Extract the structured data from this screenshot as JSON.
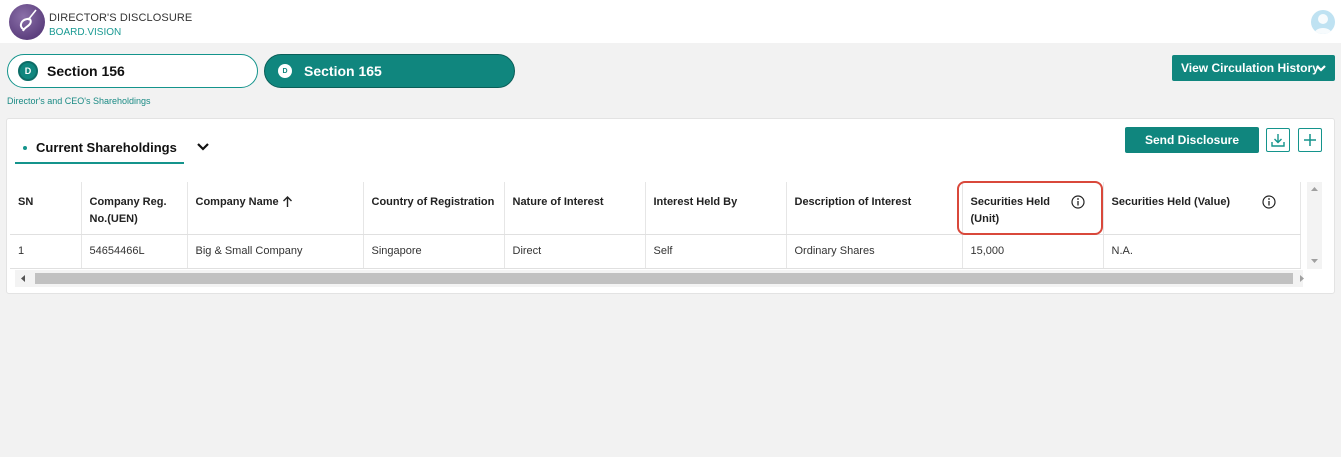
{
  "app": {
    "title": "DIRECTOR'S DISCLOSURE",
    "subtitle": "BOARD.VISION"
  },
  "sections": [
    {
      "badge": "D",
      "label": "Section 156"
    },
    {
      "badge": "D",
      "label": "Section 165"
    }
  ],
  "view_history_label": "View Circulation History",
  "breadcrumb": "Director's and CEO's Shareholdings",
  "tab_label": "Current Shareholdings",
  "send_label": "Send Disclosure",
  "table": {
    "headers": [
      "SN",
      "Company Reg. No.(UEN)",
      "Company Name",
      "Country of Registration",
      "Nature of Interest",
      "Interest Held By",
      "Description of Interest",
      "Securities Held (Unit)",
      "Securities Held (Value)"
    ],
    "rows": [
      [
        "1",
        "54654466L",
        "Big & Small Company",
        "Singapore",
        "Direct",
        "Self",
        "Ordinary Shares",
        "15,000",
        "N.A."
      ]
    ]
  },
  "colors": {
    "accent": "#10867e",
    "highlight": "#d9483b"
  },
  "icons": [
    "logo-icon",
    "avatar-icon",
    "chevron-down-icon",
    "download-icon",
    "plus-icon",
    "sort-up-icon",
    "info-icon"
  ]
}
